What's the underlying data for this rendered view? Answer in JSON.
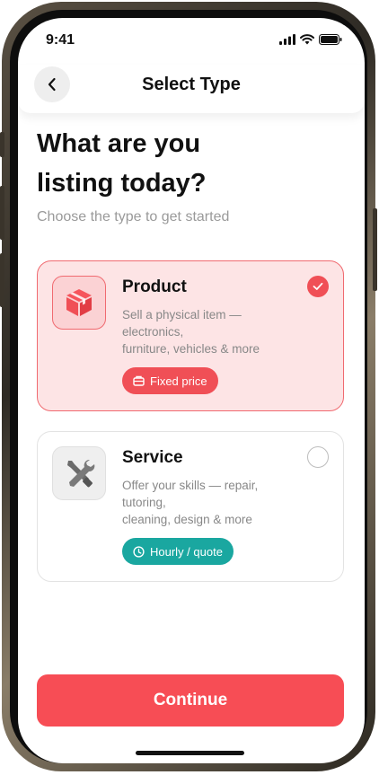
{
  "status_bar": {
    "time": "9:41",
    "icons": [
      "signal-icon",
      "wifi-icon",
      "battery-icon"
    ]
  },
  "header": {
    "title": "Select Type",
    "back_icon": "chevron-left-icon"
  },
  "main": {
    "headline_line1": "What are you",
    "headline_line2": "listing today?",
    "subtitle": "Choose the type to get started"
  },
  "options": [
    {
      "title": "Product",
      "desc_lines": [
        "Sell a physical item —",
        "electronics,",
        "furniture, vehicles & more"
      ],
      "badge": "Fixed price",
      "icon": "box-icon",
      "badge_icon": "price-tag-icon",
      "selected": true
    },
    {
      "title": "Service",
      "desc_lines": [
        "Offer your skills — repair,",
        "tutoring,",
        "cleaning, design & more"
      ],
      "badge": "Hourly / quote",
      "icon": "tools-icon",
      "badge_icon": "clock-icon",
      "selected": false
    }
  ],
  "footer": {
    "continue_label": "Continue"
  },
  "colors": {
    "accent": "#f74d55",
    "selected_bg": "#fde4e5",
    "teal": "#1aa7a0"
  }
}
